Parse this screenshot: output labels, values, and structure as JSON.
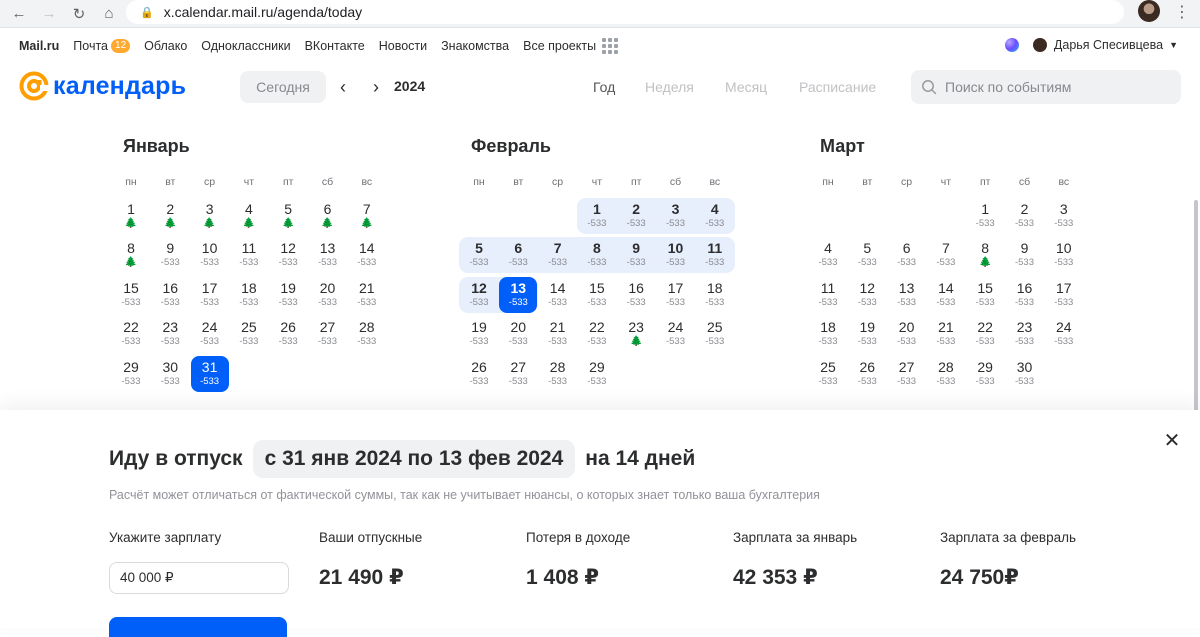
{
  "browser": {
    "url": "x.calendar.mail.ru/agenda/today",
    "back_icon": "←",
    "forward_icon": "→",
    "reload_icon": "↻",
    "home_icon": "⌂",
    "menu_icon": "⋮"
  },
  "portal": {
    "links": [
      "Mail.ru",
      "Почта",
      "Облако",
      "Одноклассники",
      "ВКонтакте",
      "Новости",
      "Знакомства",
      "Все проекты"
    ],
    "mail_badge": "12",
    "user_name": "Дарья Спесивцева"
  },
  "header": {
    "logo_text": "календарь",
    "today": "Сегодня",
    "prev": "‹",
    "next": "›",
    "year": "2024",
    "tabs": [
      "Год",
      "Неделя",
      "Месяц",
      "Расписание"
    ],
    "search_placeholder": "Поиск по событиям"
  },
  "calendar": {
    "weekdays": [
      "пн",
      "вт",
      "ср",
      "чт",
      "пт",
      "сб",
      "вс"
    ],
    "months": [
      {
        "name": "Январь",
        "first_weekday": 0,
        "days": 31,
        "tree_days": [
          1,
          2,
          3,
          4,
          5,
          6,
          7,
          8
        ],
        "selected": [
          31
        ],
        "vacation": []
      },
      {
        "name": "Февраль",
        "first_weekday": 3,
        "days": 29,
        "tree_days": [
          23
        ],
        "selected": [
          13
        ],
        "vacation": [
          1,
          2,
          3,
          4,
          5,
          6,
          7,
          8,
          9,
          10,
          11,
          12,
          13
        ]
      },
      {
        "name": "Март",
        "first_weekday": 4,
        "days": 30,
        "tree_days": [
          8
        ],
        "selected": [],
        "vacation": []
      }
    ],
    "day_value": "-533",
    "tree_glyph": "🌲"
  },
  "panel": {
    "title_prefix": "Иду в отпуск",
    "date_range": "с 31 янв 2024 по 13 фев 2024",
    "title_suffix": "на 14 дней",
    "hint": "Расчёт может отличаться от фактической суммы, так как не учитывает нюансы, о которых знает только ваша бухгалтерия",
    "salary_label": "Укажите зарплату",
    "salary_value": "40 000 ₽",
    "vacation_pay_label": "Ваши отпускные",
    "vacation_pay_value": "21 490 ₽",
    "income_loss_label": "Потеря в доходе",
    "income_loss_value": "1 408 ₽",
    "jan_salary_label": "Зарплата за январь",
    "jan_salary_value": "42 353 ₽",
    "feb_salary_label": "Зарплата за февраль",
    "feb_salary_value": "24 750₽",
    "close_icon": "✕"
  }
}
